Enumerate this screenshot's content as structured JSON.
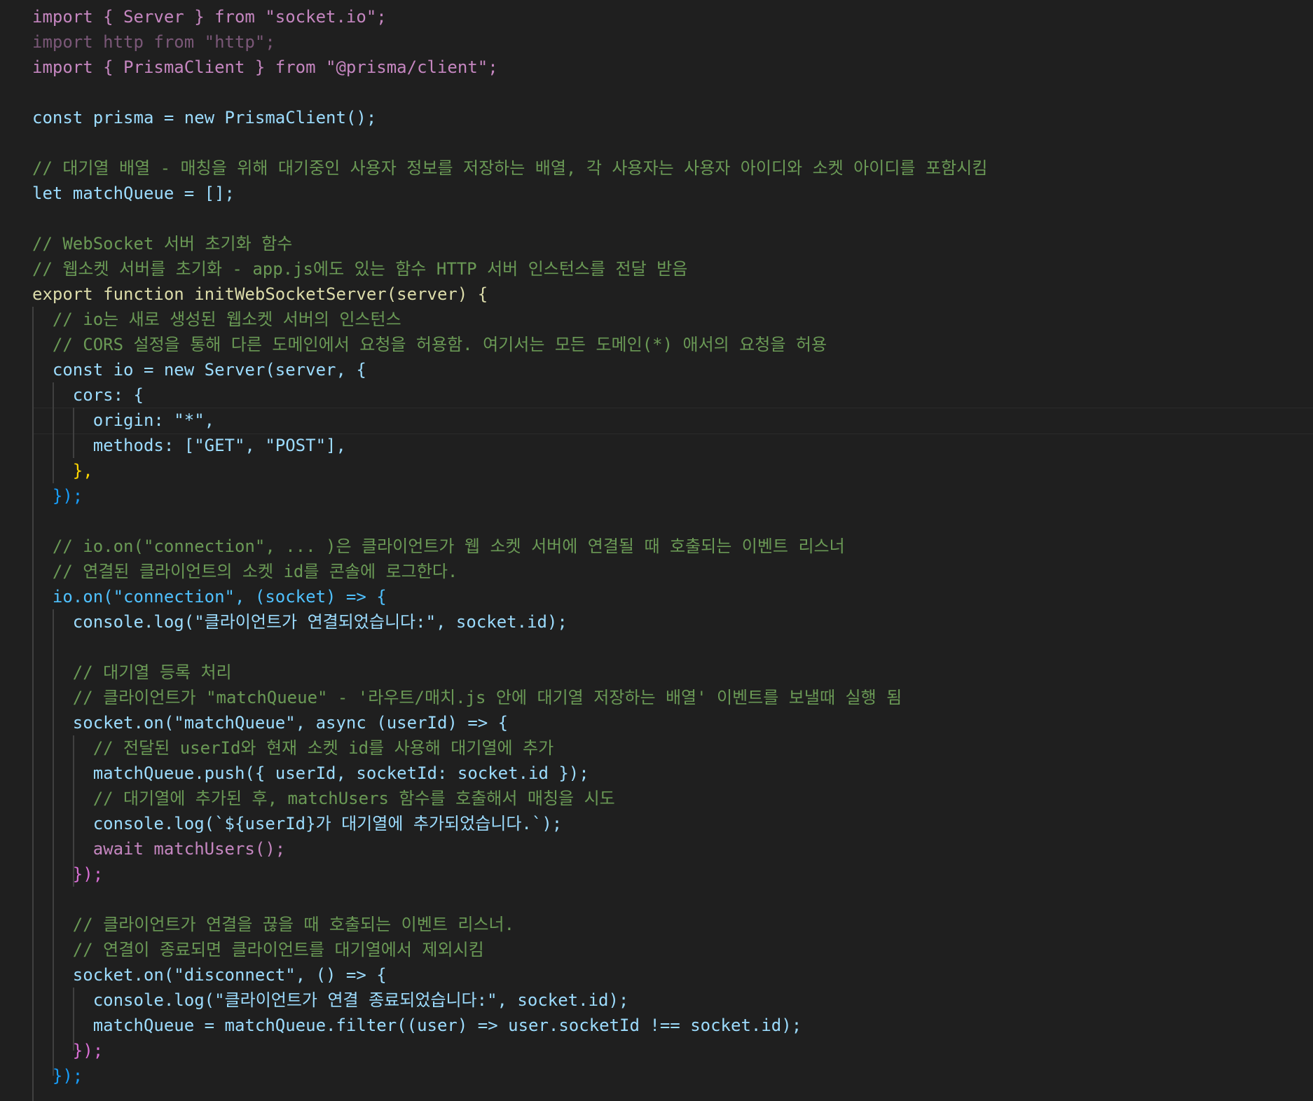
{
  "code_lines": [
    "import { Server } from \"socket.io\";",
    "import http from \"http\";",
    "import { PrismaClient } from \"@prisma/client\";",
    "",
    "const prisma = new PrismaClient();",
    "",
    "// 대기열 배열 - 매칭을 위해 대기중인 사용자 정보를 저장하는 배열, 각 사용자는 사용자 아이디와 소켓 아이디를 포함시킴",
    "let matchQueue = [];",
    "",
    "// WebSocket 서버 초기화 함수",
    "// 웹소켓 서버를 초기화 - app.js에도 있는 함수 HTTP 서버 인스턴스를 전달 받음",
    "export function initWebSocketServer(server) {",
    "  // io는 새로 생성된 웹소켓 서버의 인스턴스",
    "  // CORS 설정을 통해 다른 도메인에서 요청을 허용함. 여기서는 모든 도메인(*) 애서의 요청을 허용",
    "  const io = new Server(server, {",
    "    cors: {",
    "      origin: \"*\",",
    "      methods: [\"GET\", \"POST\"],",
    "    },",
    "  });",
    "",
    "  // io.on(\"connection\", ... )은 클라이언트가 웹 소켓 서버에 연결될 때 호출되는 이벤트 리스너",
    "  // 연결된 클라이언트의 소켓 id를 콘솔에 로그한다.",
    "  io.on(\"connection\", (socket) => {",
    "    console.log(\"클라이언트가 연결되었습니다:\", socket.id);",
    "",
    "    // 대기열 등록 처리",
    "    // 클라이언트가 \"matchQueue\" - '라우트/매치.js 안에 대기열 저장하는 배열' 이벤트를 보낼때 실행 됨",
    "    socket.on(\"matchQueue\", async (userId) => {",
    "      // 전달된 userId와 현재 소켓 id를 사용해 대기열에 추가",
    "      matchQueue.push({ userId, socketId: socket.id });",
    "      // 대기열에 추가된 후, matchUsers 함수를 호출해서 매칭을 시도",
    "      console.log(`${userId}가 대기열에 추가되었습니다.`);",
    "      await matchUsers();",
    "    });",
    "",
    "    // 클라이언트가 연결을 끊을 때 호출되는 이벤트 리스너.",
    "    // 연결이 종료되면 클라이언트를 대기열에서 제외시킴",
    "    socket.on(\"disconnect\", () => {",
    "      console.log(\"클라이언트가 연결 종료되었습니다:\", socket.id);",
    "      matchQueue = matchQueue.filter((user) => user.socketId !== socket.id);",
    "    });",
    "  });"
  ],
  "colors": {
    "background": "#1f1f1f",
    "keyword_control": "#c586c0",
    "keyword": "#569cd6",
    "function": "#dcdcaa",
    "string": "#ce9178",
    "variable": "#9cdcfe",
    "constant": "#4fc1ff",
    "class": "#4ec9b0",
    "comment": "#6a9955",
    "bracket_1": "#ffd700",
    "bracket_2": "#da70d6",
    "bracket_3": "#179fff"
  }
}
